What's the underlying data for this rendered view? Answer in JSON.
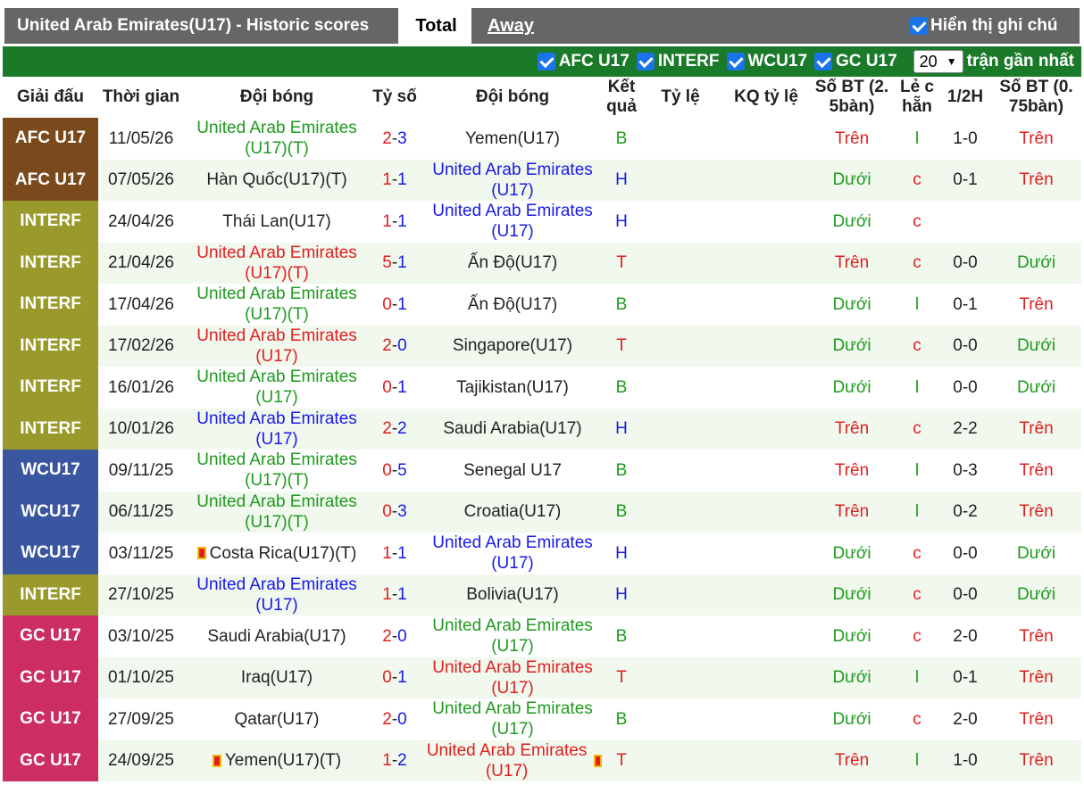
{
  "header": {
    "title": "United Arab Emirates(U17) - Historic scores",
    "tabs": {
      "total": "Total",
      "away": "Away"
    },
    "show_notes_label": "Hiển thị ghi chú"
  },
  "filters": {
    "items": [
      {
        "label": "AFC U17",
        "checked": true
      },
      {
        "label": "INTERF",
        "checked": true
      },
      {
        "label": "WCU17",
        "checked": true
      },
      {
        "label": "GC U17",
        "checked": true
      }
    ],
    "count_value": "20",
    "count_suffix": "trận gần nhất"
  },
  "columns": {
    "league": "Giải đấu",
    "time": "Thời gian",
    "home": "Đội bóng",
    "score": "Tỷ số",
    "away": "Đội bóng",
    "result_l1": "Kết",
    "result_l2": "quả",
    "odds": "Tỷ lệ",
    "odds_result": "KQ tỷ lệ",
    "goals25_l1": "Số BT (2.",
    "goals25_l2": "5bàn)",
    "oddeven_l1": "Lẻ c",
    "oddeven_l2": "hẵn",
    "half": "1/2H",
    "goals075_l1": "Số BT (0.",
    "goals075_l2": "75bàn)"
  },
  "colors": {
    "AFC U17": "#7a4a1c",
    "INTERF": "#9a9a2c",
    "WCU17": "#3a56a0",
    "GC U17": "#cc2e62"
  },
  "rows": [
    {
      "league": "AFC U17",
      "date": "11/05/26",
      "home": "United Arab Emirates (U17)(T)",
      "home_color": "green",
      "home_score": "2",
      "away_score": "3",
      "away": "Yemen(U17)",
      "away_color": "black",
      "result": "B",
      "ou": "Trên",
      "ou_color": "red",
      "oe": "l",
      "half": "1-0",
      "ou075": "Trên",
      "ou075_color": "red"
    },
    {
      "league": "AFC U17",
      "date": "07/05/26",
      "home": "Hàn Quốc(U17)(T)",
      "home_color": "black",
      "home_score": "1",
      "away_score": "1",
      "away": "United Arab Emirates (U17)",
      "away_color": "blue",
      "result": "H",
      "ou": "Dưới",
      "ou_color": "green",
      "oe": "c",
      "half": "0-1",
      "ou075": "Trên",
      "ou075_color": "red"
    },
    {
      "league": "INTERF",
      "date": "24/04/26",
      "home": "Thái Lan(U17)",
      "home_color": "black",
      "home_score": "1",
      "away_score": "1",
      "away": "United Arab Emirates (U17)",
      "away_color": "blue",
      "result": "H",
      "ou": "Dưới",
      "ou_color": "green",
      "oe": "c",
      "half": "",
      "ou075": "",
      "ou075_color": "red"
    },
    {
      "league": "INTERF",
      "date": "21/04/26",
      "home": "United Arab Emirates (U17)(T)",
      "home_color": "red",
      "home_score": "5",
      "away_score": "1",
      "away": "Ấn Độ(U17)",
      "away_color": "black",
      "result": "T",
      "ou": "Trên",
      "ou_color": "red",
      "oe": "c",
      "half": "0-0",
      "ou075": "Dưới",
      "ou075_color": "green"
    },
    {
      "league": "INTERF",
      "date": "17/04/26",
      "home": "United Arab Emirates (U17)(T)",
      "home_color": "green",
      "home_score": "0",
      "away_score": "1",
      "away": "Ấn Độ(U17)",
      "away_color": "black",
      "result": "B",
      "ou": "Dưới",
      "ou_color": "green",
      "oe": "l",
      "half": "0-1",
      "ou075": "Trên",
      "ou075_color": "red"
    },
    {
      "league": "INTERF",
      "date": "17/02/26",
      "home": "United Arab Emirates (U17)",
      "home_color": "red",
      "home_score": "2",
      "away_score": "0",
      "away": "Singapore(U17)",
      "away_color": "black",
      "result": "T",
      "ou": "Dưới",
      "ou_color": "green",
      "oe": "c",
      "half": "0-0",
      "ou075": "Dưới",
      "ou075_color": "green"
    },
    {
      "league": "INTERF",
      "date": "16/01/26",
      "home": "United Arab Emirates (U17)",
      "home_color": "green",
      "home_score": "0",
      "away_score": "1",
      "away": "Tajikistan(U17)",
      "away_color": "black",
      "result": "B",
      "ou": "Dưới",
      "ou_color": "green",
      "oe": "l",
      "half": "0-0",
      "ou075": "Dưới",
      "ou075_color": "green"
    },
    {
      "league": "INTERF",
      "date": "10/01/26",
      "home": "United Arab Emirates (U17)",
      "home_color": "blue",
      "home_score": "2",
      "away_score": "2",
      "away": "Saudi Arabia(U17)",
      "away_color": "black",
      "result": "H",
      "ou": "Trên",
      "ou_color": "red",
      "oe": "c",
      "half": "2-2",
      "ou075": "Trên",
      "ou075_color": "red"
    },
    {
      "league": "WCU17",
      "date": "09/11/25",
      "home": "United Arab Emirates (U17)(T)",
      "home_color": "green",
      "home_score": "0",
      "away_score": "5",
      "away": "Senegal U17",
      "away_color": "black",
      "result": "B",
      "ou": "Trên",
      "ou_color": "red",
      "oe": "l",
      "half": "0-3",
      "ou075": "Trên",
      "ou075_color": "red"
    },
    {
      "league": "WCU17",
      "date": "06/11/25",
      "home": "United Arab Emirates (U17)(T)",
      "home_color": "green",
      "home_score": "0",
      "away_score": "3",
      "away": "Croatia(U17)",
      "away_color": "black",
      "result": "B",
      "ou": "Trên",
      "ou_color": "red",
      "oe": "l",
      "half": "0-2",
      "ou075": "Trên",
      "ou075_color": "red"
    },
    {
      "league": "WCU17",
      "date": "03/11/25",
      "home": "Costa Rica(U17)(T)",
      "home_color": "black",
      "home_flag": true,
      "home_score": "1",
      "away_score": "1",
      "away": "United Arab Emirates (U17)",
      "away_color": "blue",
      "result": "H",
      "ou": "Dưới",
      "ou_color": "green",
      "oe": "c",
      "half": "0-0",
      "ou075": "Dưới",
      "ou075_color": "green"
    },
    {
      "league": "INTERF",
      "date": "27/10/25",
      "home": "United Arab Emirates (U17)",
      "home_color": "blue",
      "home_score": "1",
      "away_score": "1",
      "away": "Bolivia(U17)",
      "away_color": "black",
      "result": "H",
      "ou": "Dưới",
      "ou_color": "green",
      "oe": "c",
      "half": "0-0",
      "ou075": "Dưới",
      "ou075_color": "green"
    },
    {
      "league": "GC U17",
      "date": "03/10/25",
      "home": "Saudi Arabia(U17)",
      "home_color": "black",
      "home_score": "2",
      "away_score": "0",
      "away": "United Arab Emirates (U17)",
      "away_color": "green",
      "result": "B",
      "ou": "Dưới",
      "ou_color": "green",
      "oe": "c",
      "half": "2-0",
      "ou075": "Trên",
      "ou075_color": "red"
    },
    {
      "league": "GC U17",
      "date": "01/10/25",
      "home": "Iraq(U17)",
      "home_color": "black",
      "home_score": "0",
      "away_score": "1",
      "away": "United Arab Emirates (U17)",
      "away_color": "red",
      "result": "T",
      "ou": "Dưới",
      "ou_color": "green",
      "oe": "l",
      "half": "0-1",
      "ou075": "Trên",
      "ou075_color": "red"
    },
    {
      "league": "GC U17",
      "date": "27/09/25",
      "home": "Qatar(U17)",
      "home_color": "black",
      "home_score": "2",
      "away_score": "0",
      "away": "United Arab Emirates (U17)",
      "away_color": "green",
      "result": "B",
      "ou": "Dưới",
      "ou_color": "green",
      "oe": "c",
      "half": "2-0",
      "ou075": "Trên",
      "ou075_color": "red"
    },
    {
      "league": "GC U17",
      "date": "24/09/25",
      "home": "Yemen(U17)(T)",
      "home_color": "black",
      "home_flag": true,
      "home_score": "1",
      "away_score": "2",
      "away": "United Arab Emirates (U17)",
      "away_color": "red",
      "away_flag": true,
      "result": "T",
      "ou": "Trên",
      "ou_color": "red",
      "oe": "l",
      "half": "1-0",
      "ou075": "Trên",
      "ou075_color": "red"
    }
  ]
}
